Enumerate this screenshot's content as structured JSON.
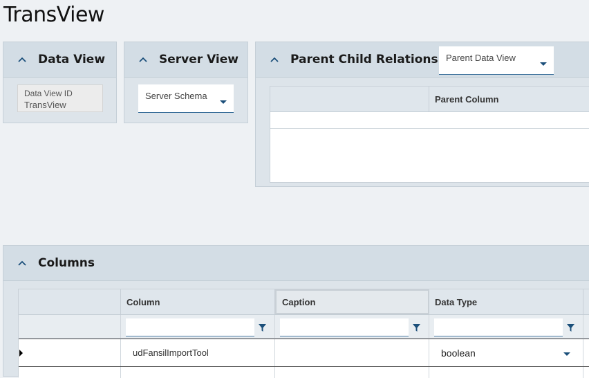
{
  "page": {
    "title": "TransView"
  },
  "data_view_panel": {
    "title": "Data View",
    "field": {
      "label": "Data View ID",
      "value": "TransView"
    }
  },
  "server_view_panel": {
    "title": "Server View",
    "dropdown": {
      "placeholder": "Server Schema"
    }
  },
  "parent_child_panel": {
    "title": "Parent Child Relationships",
    "dropdown": {
      "placeholder": "Parent Data View"
    },
    "grid": {
      "columns": [
        "",
        "Parent Column"
      ]
    }
  },
  "columns_panel": {
    "title": "Columns",
    "grid": {
      "columns": [
        "",
        "Column",
        "Caption",
        "Data Type"
      ],
      "rows": [
        {
          "column": "udFansilImportTool",
          "caption": "",
          "data_type": "boolean"
        }
      ]
    }
  },
  "colors": {
    "accent": "#1b4f7a",
    "panel_bg": "#dde4ea",
    "header_bg": "#d3dde5"
  }
}
